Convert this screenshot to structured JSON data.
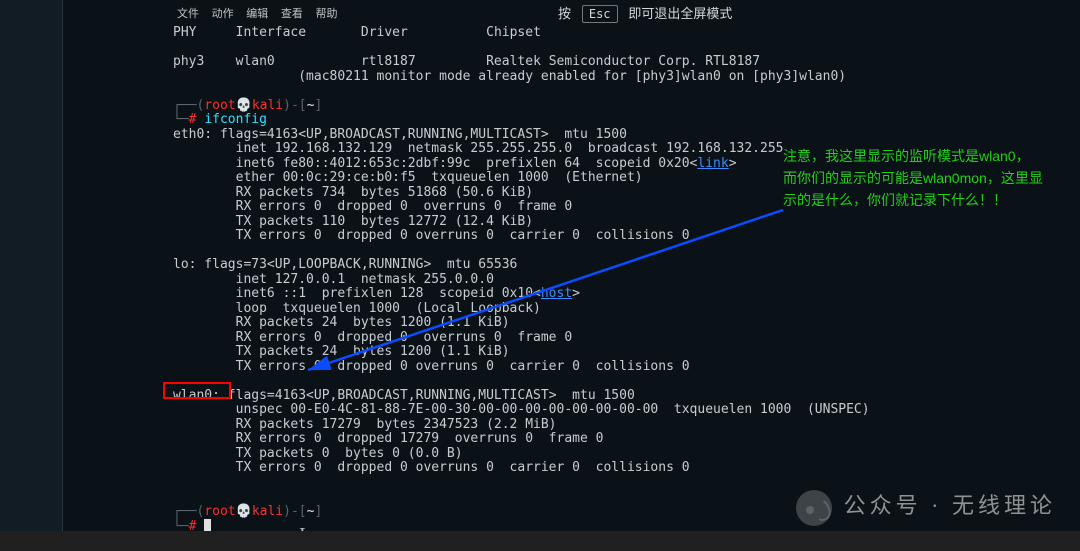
{
  "menubar": {
    "items": [
      "文件",
      "动作",
      "编辑",
      "查看",
      "帮助"
    ]
  },
  "fullscreen_hint": {
    "pre": "按",
    "key": "Esc",
    "post": "即可退出全屏模式"
  },
  "header": {
    "c0": "PHY",
    "c1": "Interface",
    "c2": "Driver",
    "c3": "Chipset"
  },
  "dev": {
    "phy": "phy3",
    "iface": "wlan0",
    "driver": "rtl8187",
    "chipset": "Realtek Semiconductor Corp. RTL8187",
    "note": "(mac80211 monitor mode already enabled for [phy3]wlan0 on [phy3]wlan0)"
  },
  "prompt": {
    "open": "(",
    "user": "root",
    "skull": "💀",
    "host": "kali",
    "close": ")-[",
    "cwd": "~",
    "end": "]",
    "sigil": "#"
  },
  "cmd1": "ifconfig",
  "eth0": {
    "head": "eth0: flags=4163<UP,BROADCAST,RUNNING,MULTICAST>  mtu 1500",
    "l1": "        inet 192.168.132.129  netmask 255.255.255.0  broadcast 192.168.132.255",
    "l2a": "        inet6 fe80::4012:653c:2dbf:99c  prefixlen 64  scopeid 0x20<",
    "l2link": "link",
    "l2b": ">",
    "l3": "        ether 00:0c:29:ce:b0:f5  txqueuelen 1000  (Ethernet)",
    "l4": "        RX packets 734  bytes 51868 (50.6 KiB)",
    "l5": "        RX errors 0  dropped 0  overruns 0  frame 0",
    "l6": "        TX packets 110  bytes 12772 (12.4 KiB)",
    "l7": "        TX errors 0  dropped 0 overruns 0  carrier 0  collisions 0"
  },
  "lo": {
    "head": "lo: flags=73<UP,LOOPBACK,RUNNING>  mtu 65536",
    "l1": "        inet 127.0.0.1  netmask 255.0.0.0",
    "l2a": "        inet6 ::1  prefixlen 128  scopeid 0x10<",
    "l2link": "host",
    "l2b": ">",
    "l3": "        loop  txqueuelen 1000  (Local Loopback)",
    "l4": "        RX packets 24  bytes 1200 (1.1 KiB)",
    "l5": "        RX errors 0  dropped 0  overruns 0  frame 0",
    "l6": "        TX packets 24  bytes 1200 (1.1 KiB)",
    "l7": "        TX errors 0  dropped 0 overruns 0  carrier 0  collisions 0"
  },
  "wlan0": {
    "label": "wlan0:",
    "rest": " flags=4163<UP,BROADCAST,RUNNING,MULTICAST>  mtu 1500",
    "l1": "        unspec 00-E0-4C-81-88-7E-00-30-00-00-00-00-00-00-00-00  txqueuelen 1000  (UNSPEC)",
    "l2": "        RX packets 17279  bytes 2347523 (2.2 MiB)",
    "l3": "        RX errors 0  dropped 17279  overruns 0  frame 0",
    "l4": "        TX packets 0  bytes 0 (0.0 B)",
    "l5": "        TX errors 0  dropped 0 overruns 0  carrier 0  collisions 0"
  },
  "annotation": "注意，我这里显示的监听模式是wlan0，\n而你们的显示的可能是wlan0mon，这里显\n示的是什么，你们就记录下什么！！",
  "watermark": "公众号 · 无线理论"
}
